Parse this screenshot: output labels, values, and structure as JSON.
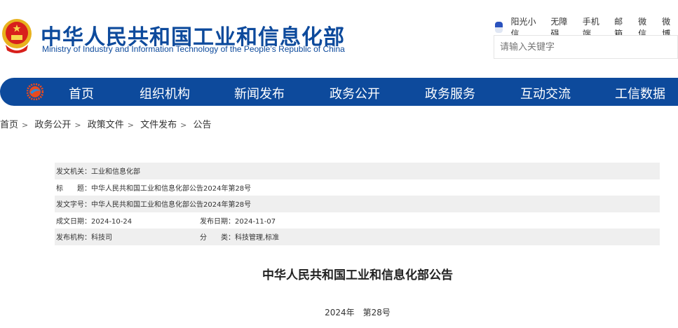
{
  "header": {
    "title_cn": "中华人民共和国工业和信息化部",
    "title_en": "Ministry of Industry and Information Technology of the People’s Republic of China",
    "links": [
      "阳光小信",
      "无障碍",
      "手机端",
      "邮箱",
      "微信",
      "微博"
    ],
    "search_placeholder": "请输入关键字"
  },
  "nav": {
    "items": [
      "首页",
      "组织机构",
      "新闻发布",
      "政务公开",
      "政务服务",
      "互动交流",
      "工信数据"
    ]
  },
  "breadcrumb": [
    "首页",
    "政务公开",
    "政策文件",
    "文件发布",
    "公告"
  ],
  "meta": {
    "issuer_label": "发文机关：",
    "issuer": "工业和信息化部",
    "title_label": "标　　题：",
    "title": "中华人民共和国工业和信息化部公告2024年第28号",
    "docno_label": "发文字号：",
    "docno": "中华人民共和国工业和信息化部公告2024年第28号",
    "written_label": "成文日期：",
    "written": "2024-10-24",
    "published_label": "发布日期：",
    "published": "2024-11-07",
    "org_label": "发布机构：",
    "org": "科技司",
    "category_label": "分　　类：",
    "category": "科技管理,标准"
  },
  "document": {
    "title": "中华人民共和国工业和信息化部公告",
    "number": "2024年　第28号"
  },
  "colors": {
    "brand": "#0d4a9c"
  }
}
